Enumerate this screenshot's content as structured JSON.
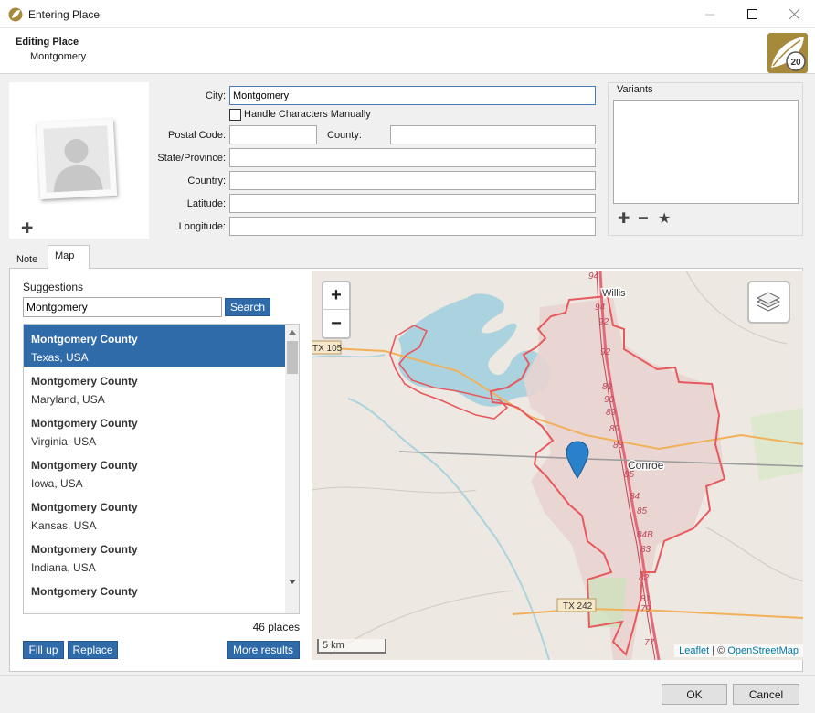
{
  "window": {
    "title": "Entering Place"
  },
  "header": {
    "heading": "Editing Place",
    "subheading": "Montgomery",
    "logo_badge": "20"
  },
  "form": {
    "city_label": "City:",
    "city_value": "Montgomery",
    "handle_chars_label": "Handle Characters Manually",
    "postal_label": "Postal Code:",
    "postal_value": "",
    "county_label": "County:",
    "county_value": "",
    "state_label": "State/Province:",
    "state_value": "",
    "country_label": "Country:",
    "country_value": "",
    "latitude_label": "Latitude:",
    "latitude_value": "",
    "longitude_label": "Longitude:",
    "longitude_value": ""
  },
  "variants": {
    "title": "Variants",
    "icons": [
      "add-icon",
      "remove-icon",
      "star-icon"
    ]
  },
  "tabs": [
    {
      "label": "Note"
    },
    {
      "label": "Map"
    }
  ],
  "suggestions": {
    "label": "Suggestions",
    "query": "Montgomery",
    "search_label": "Search",
    "results": [
      {
        "name": "Montgomery County",
        "region": "Texas, USA",
        "selected": true
      },
      {
        "name": "Montgomery County",
        "region": "Maryland, USA"
      },
      {
        "name": "Montgomery County",
        "region": "Virginia, USA"
      },
      {
        "name": "Montgomery County",
        "region": "Iowa, USA"
      },
      {
        "name": "Montgomery County",
        "region": "Kansas, USA"
      },
      {
        "name": "Montgomery County",
        "region": "Indiana, USA"
      },
      {
        "name": "Montgomery County",
        "region": ""
      }
    ],
    "count_text": "46 places",
    "fill_up_label": "Fill up",
    "replace_label": "Replace",
    "more_results_label": "More results"
  },
  "map": {
    "zoom_in": "+",
    "zoom_out": "−",
    "scale_label": "5 km",
    "attribution_leaflet": "Leaflet",
    "attribution_sep": " | © ",
    "attribution_osm": "OpenStreetMap",
    "labels": {
      "willis": "Willis",
      "conroe": "Conroe",
      "tx105": "TX 105",
      "tx242": "TX 242",
      "r94": "94",
      "r94b": "94",
      "r92": "92",
      "r92b": "92",
      "r89a": "89",
      "r90": "90",
      "r89b": "89",
      "r89c": "89",
      "r88": "88",
      "r85a": "85",
      "r84": "84",
      "r85b": "85",
      "r84b": "84B",
      "r83": "83",
      "r82": "82",
      "r81": "81",
      "r79": "79",
      "r77": "77"
    },
    "colors": {
      "water": "#aad3df",
      "land": "#ede8e1",
      "boundary": "#e8595e",
      "urban": "#e8d4d0",
      "marker": "#2a81cb"
    }
  },
  "footer": {
    "ok_label": "OK",
    "cancel_label": "Cancel"
  }
}
